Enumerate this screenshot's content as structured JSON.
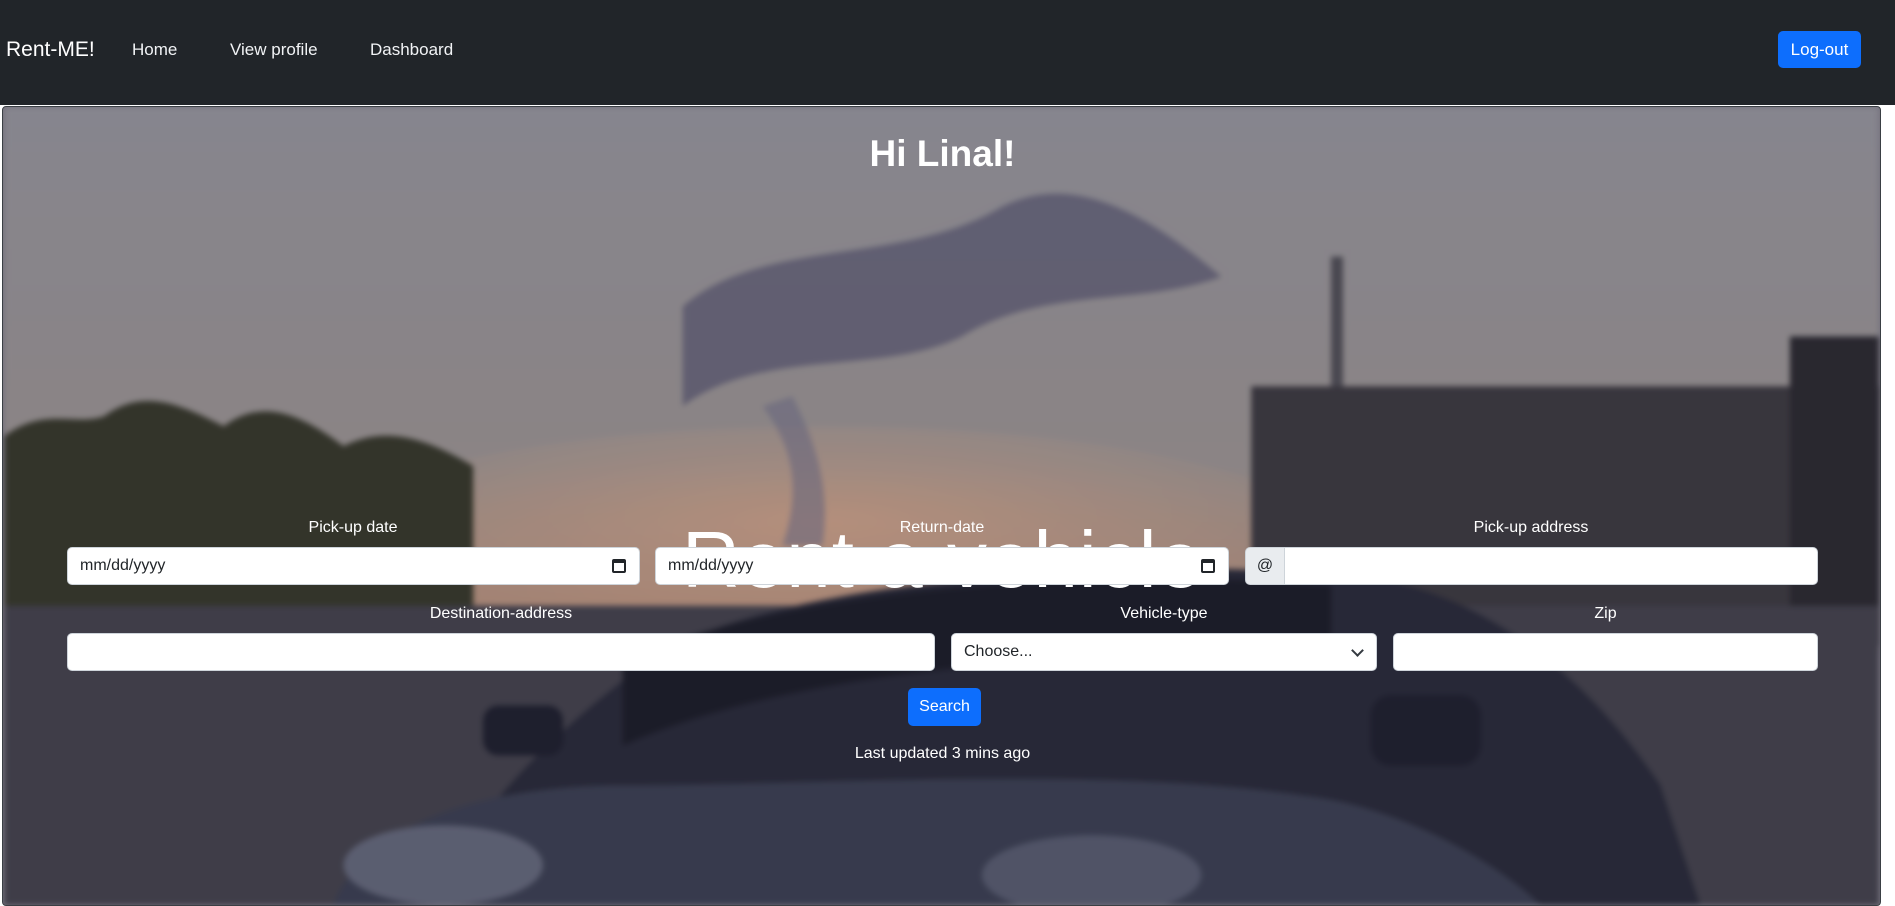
{
  "nav": {
    "brand": "Rent-ME!",
    "links": [
      "Home",
      "View profile",
      "Dashboard"
    ],
    "logout": "Log-out"
  },
  "hero": {
    "greeting": "Hi Linal!",
    "title": "Rent a vehicle"
  },
  "form": {
    "pickup_date": {
      "label": "Pick-up date",
      "placeholder": "mm/dd/yyyy"
    },
    "return_date": {
      "label": "Return-date",
      "placeholder": "mm/dd/yyyy"
    },
    "pickup_address": {
      "label": "Pick-up address",
      "addon": "@",
      "value": ""
    },
    "destination": {
      "label": "Destination-address",
      "value": ""
    },
    "vehicle_type": {
      "label": "Vehicle-type",
      "selected": "Choose..."
    },
    "zip": {
      "label": "Zip",
      "value": ""
    },
    "search": "Search",
    "last_updated": "Last updated 3 mins ago"
  },
  "colors": {
    "navbar": "#212529",
    "primary": "#0d6efd"
  }
}
